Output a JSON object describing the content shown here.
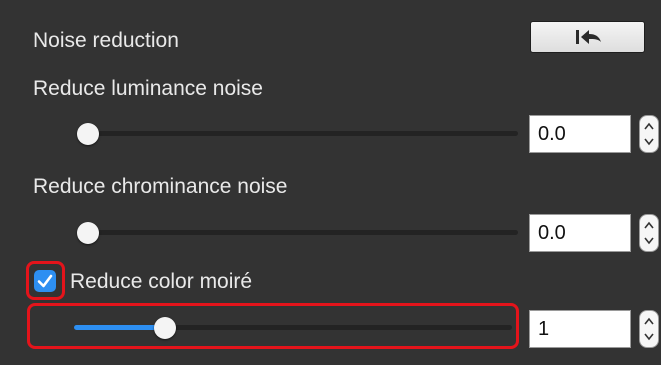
{
  "panel": {
    "title": "Noise reduction",
    "reset_icon": "reset-to-default-icon",
    "luminance": {
      "label": "Reduce luminance noise",
      "value": "0.0",
      "slider_fraction": 0.0
    },
    "chrominance": {
      "label": "Reduce chrominance noise",
      "value": "0.0",
      "slider_fraction": 0.0
    },
    "moire": {
      "label": "Reduce color moiré",
      "checked": true,
      "value": "1",
      "slider_fraction": 0.2
    }
  },
  "colors": {
    "panel_background": "#333333",
    "accent_blue": "#2d8ff2",
    "highlight_red": "#e4141b"
  }
}
